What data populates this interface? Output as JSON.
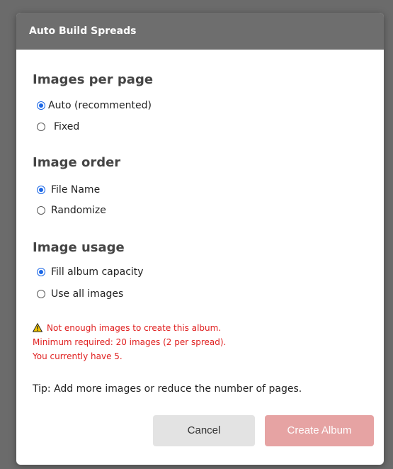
{
  "dialog": {
    "title": "Auto Build Spreads",
    "sections": {
      "images_per_page": {
        "title": "Images per page",
        "options": [
          {
            "label": "Auto (recommented)",
            "selected": true
          },
          {
            "label": "Fixed",
            "selected": false
          }
        ]
      },
      "image_order": {
        "title": "Image order",
        "options": [
          {
            "label": "File Name",
            "selected": true
          },
          {
            "label": "Randomize",
            "selected": false
          }
        ]
      },
      "image_usage": {
        "title": "Image usage",
        "options": [
          {
            "label": "Fill album capacity",
            "selected": true
          },
          {
            "label": "Use all images",
            "selected": false
          }
        ]
      }
    },
    "warning": {
      "icon": "warning-triangle-icon",
      "line1": "Not enough images to create this album.",
      "line2": "Minimum required: 20 images (2 per spread).",
      "line3": "You currently have 5."
    },
    "tip": "Tip: Add more images or reduce the number of pages.",
    "buttons": {
      "cancel": "Cancel",
      "create": "Create Album"
    },
    "colors": {
      "accent": "#1a66e6",
      "warning": "#e02020",
      "create_disabled": "#e6a3a3",
      "titlebar": "#6e6e6e"
    }
  }
}
